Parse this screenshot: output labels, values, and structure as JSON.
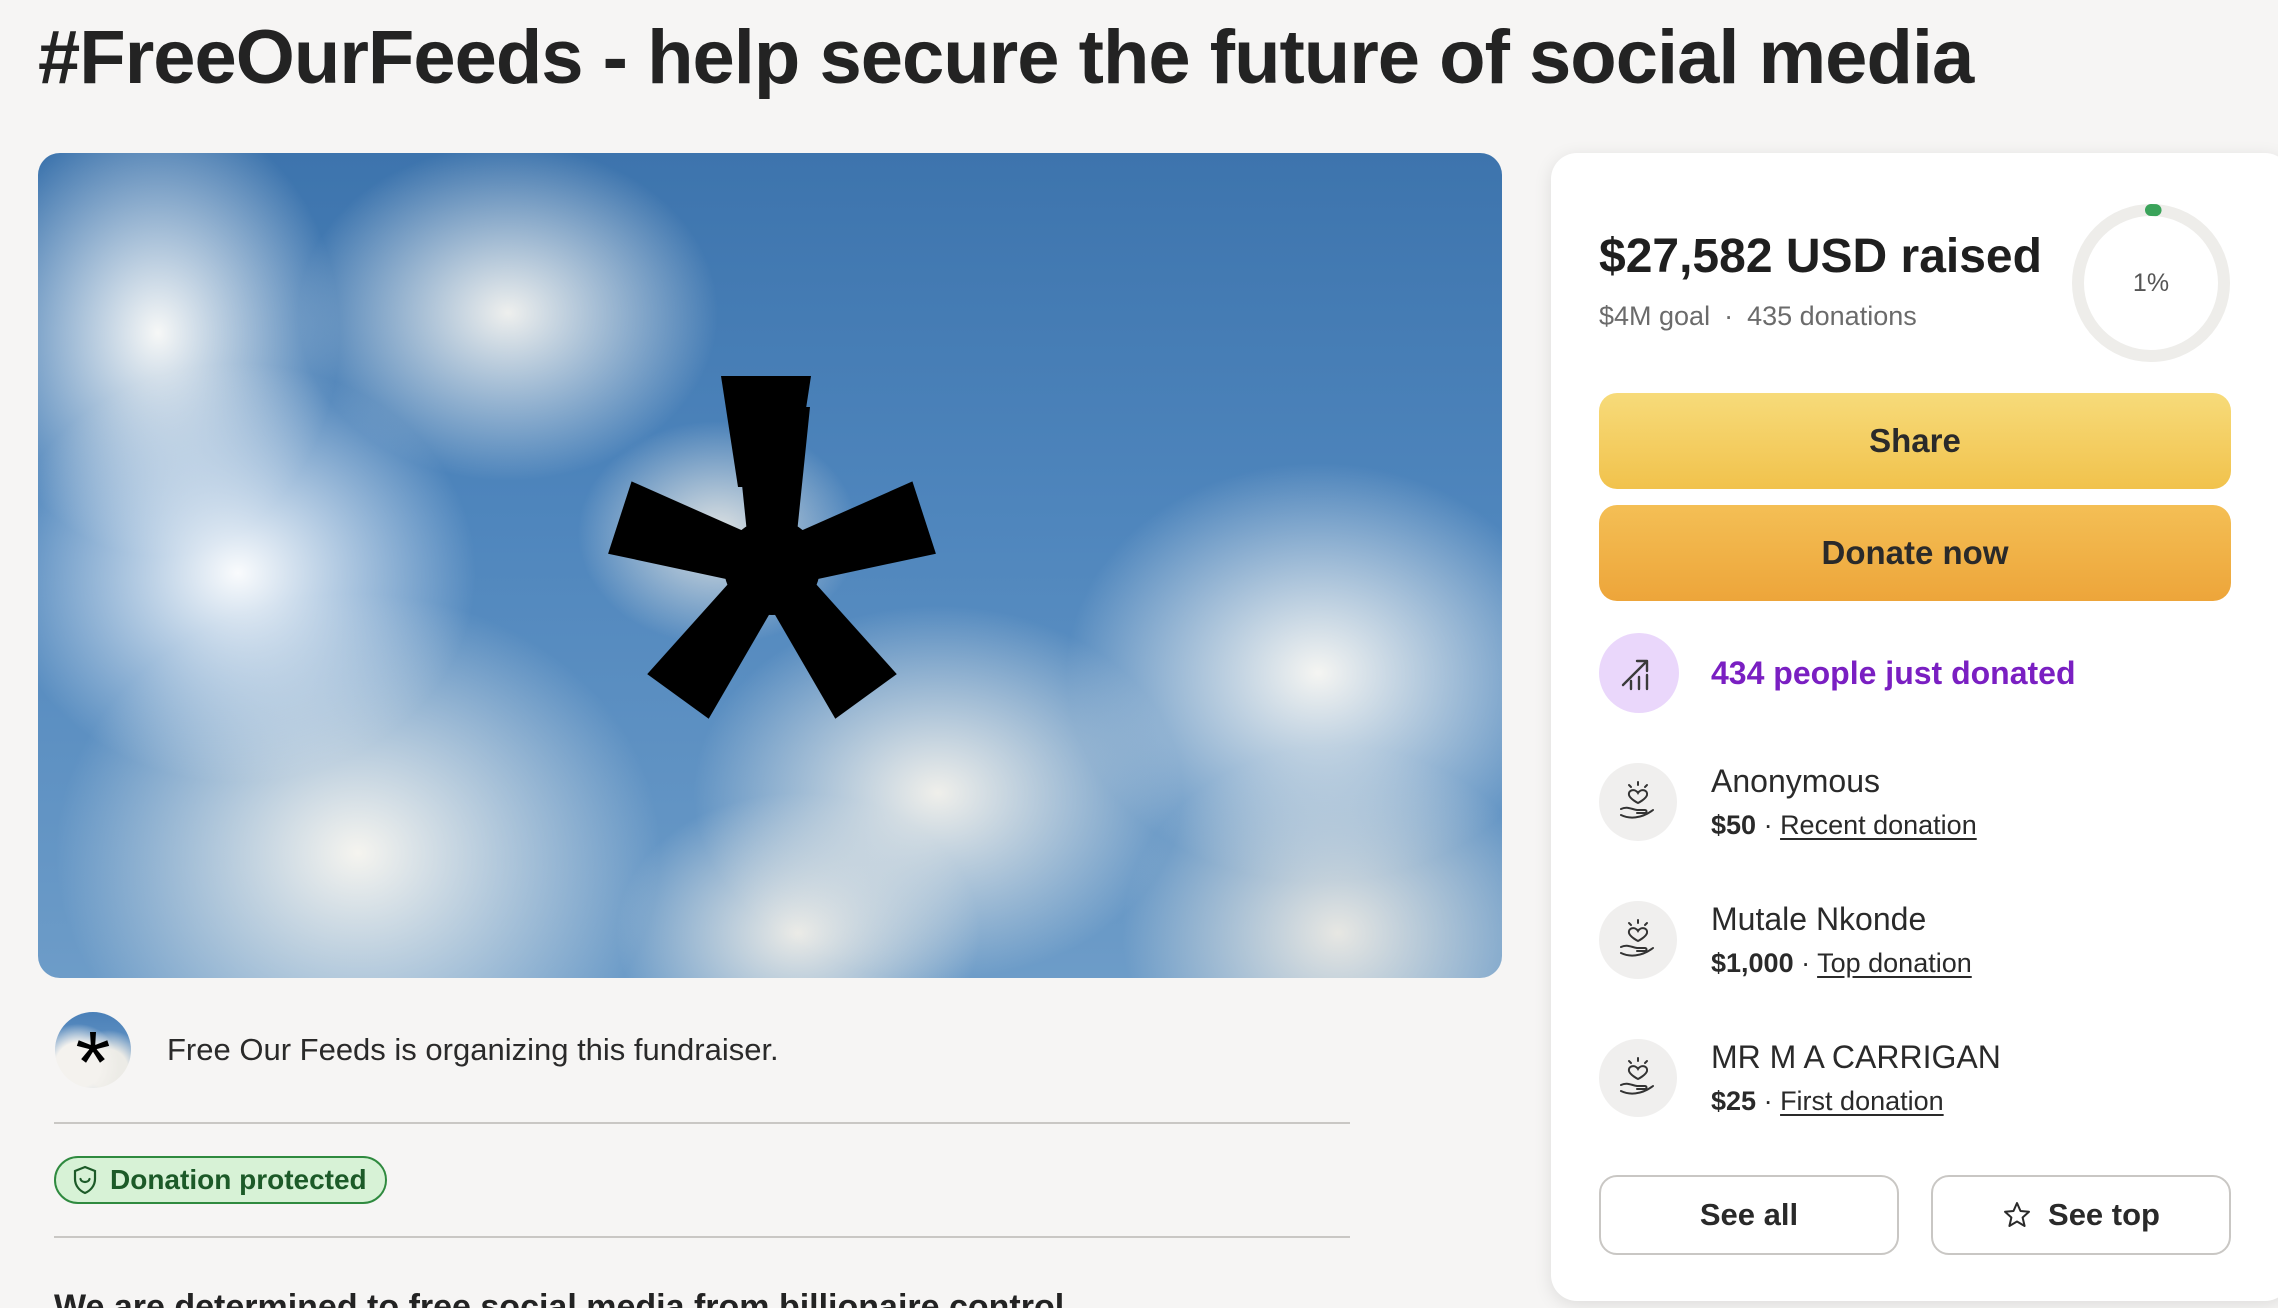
{
  "page": {
    "title": "#FreeOurFeeds - help secure the future of social media"
  },
  "organizer": {
    "text": "Free Our Feeds is organizing this fundraiser."
  },
  "badge": {
    "label": "Donation protected",
    "icon": "shield-icon"
  },
  "description": {
    "first_line": "We are determined to free social media from billionaire control"
  },
  "summary": {
    "raised": "$27,582 USD raised",
    "goal": "$4M goal",
    "separator": "·",
    "donations": "435 donations",
    "progress_label": "1%",
    "progress_fraction": 0.01
  },
  "actions": {
    "share_label": "Share",
    "donate_label": "Donate now",
    "see_all_label": "See all",
    "see_top_label": "See top"
  },
  "activity": {
    "text": "434 people just donated",
    "icon": "trending-up-icon"
  },
  "donors": [
    {
      "name": "Anonymous",
      "amount": "$50",
      "sep": " · ",
      "tag": "Recent donation"
    },
    {
      "name": "Mutale Nkonde",
      "amount": "$1,000",
      "sep": " · ",
      "tag": "Top donation"
    },
    {
      "name": "MR M A CARRIGAN",
      "amount": "$25",
      "sep": " · ",
      "tag": "First donation"
    }
  ],
  "colors": {
    "accent_purple": "#7a1fc2",
    "share_yellow": "#f1c24c",
    "donate_orange": "#eda53a",
    "protected_green": "#2f8a3f",
    "progress_green": "#3aa35a"
  }
}
